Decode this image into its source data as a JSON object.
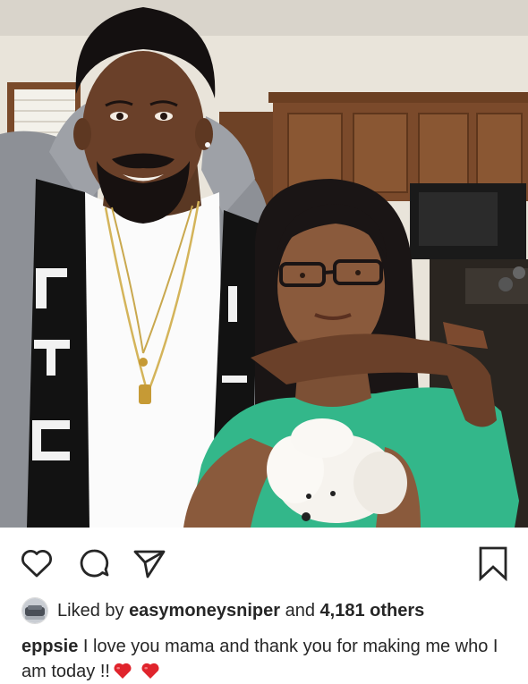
{
  "post": {
    "actions": {
      "like_icon": "heart-outline-icon",
      "comment_icon": "comment-bubble-icon",
      "share_icon": "paper-plane-icon",
      "save_icon": "bookmark-icon"
    },
    "likes": {
      "prefix": "Liked by",
      "user": "easymoneysniper",
      "conjunction": "and",
      "others": "4,181 others"
    },
    "caption": {
      "username": "eppsie",
      "text": "I love you mama and thank you for making me who I am today !!",
      "emojis": [
        "red-heart",
        "red-heart"
      ]
    }
  },
  "colors": {
    "text": "#262626",
    "heart_emoji": "#e0242c",
    "background": "#ffffff"
  }
}
